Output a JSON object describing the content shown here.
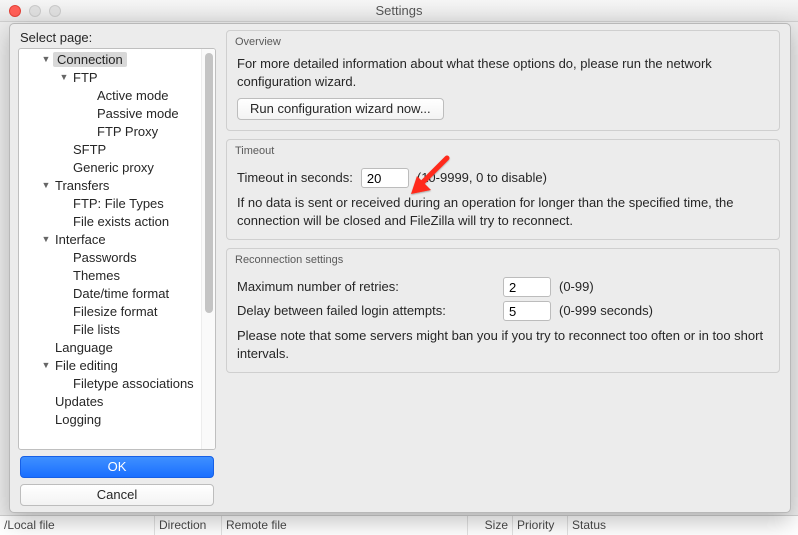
{
  "window_title": "Settings",
  "sidebar": {
    "label": "Select page:",
    "items": [
      {
        "label": "Connection",
        "level": 1,
        "arrow": true,
        "selected": true
      },
      {
        "label": "FTP",
        "level": 2,
        "arrow": true
      },
      {
        "label": "Active mode",
        "level": 3
      },
      {
        "label": "Passive mode",
        "level": 3
      },
      {
        "label": "FTP Proxy",
        "level": 3
      },
      {
        "label": "SFTP",
        "level": 2
      },
      {
        "label": "Generic proxy",
        "level": 2
      },
      {
        "label": "Transfers",
        "level": 1,
        "arrow": true
      },
      {
        "label": "FTP: File Types",
        "level": 2
      },
      {
        "label": "File exists action",
        "level": 2
      },
      {
        "label": "Interface",
        "level": 1,
        "arrow": true
      },
      {
        "label": "Passwords",
        "level": 2
      },
      {
        "label": "Themes",
        "level": 2
      },
      {
        "label": "Date/time format",
        "level": 2
      },
      {
        "label": "Filesize format",
        "level": 2
      },
      {
        "label": "File lists",
        "level": 2
      },
      {
        "label": "Language",
        "level": 1
      },
      {
        "label": "File editing",
        "level": 1,
        "arrow": true
      },
      {
        "label": "Filetype associations",
        "level": 2
      },
      {
        "label": "Updates",
        "level": 1
      },
      {
        "label": "Logging",
        "level": 1
      }
    ],
    "ok": "OK",
    "cancel": "Cancel"
  },
  "overview": {
    "title": "Overview",
    "text": "For more detailed information about what these options do, please run the network configuration wizard.",
    "button": "Run configuration wizard now..."
  },
  "timeout": {
    "title": "Timeout",
    "label": "Timeout in seconds:",
    "value": "20",
    "hint": "(10-9999, 0 to disable)",
    "note": "If no data is sent or received during an operation for longer than the specified time, the connection will be closed and FileZilla will try to reconnect."
  },
  "reconnect": {
    "title": "Reconnection settings",
    "retries_label": "Maximum number of retries:",
    "retries_value": "2",
    "retries_hint": "(0-99)",
    "delay_label": "Delay between failed login attempts:",
    "delay_value": "5",
    "delay_hint": "(0-999 seconds)",
    "note": "Please note that some servers might ban you if you try to reconnect too often or in too short intervals."
  },
  "bg": {
    "localfile": "/Local file",
    "direction": "Direction",
    "remotefile": "Remote file",
    "size": "Size",
    "priority": "Priority",
    "status": "Status"
  }
}
